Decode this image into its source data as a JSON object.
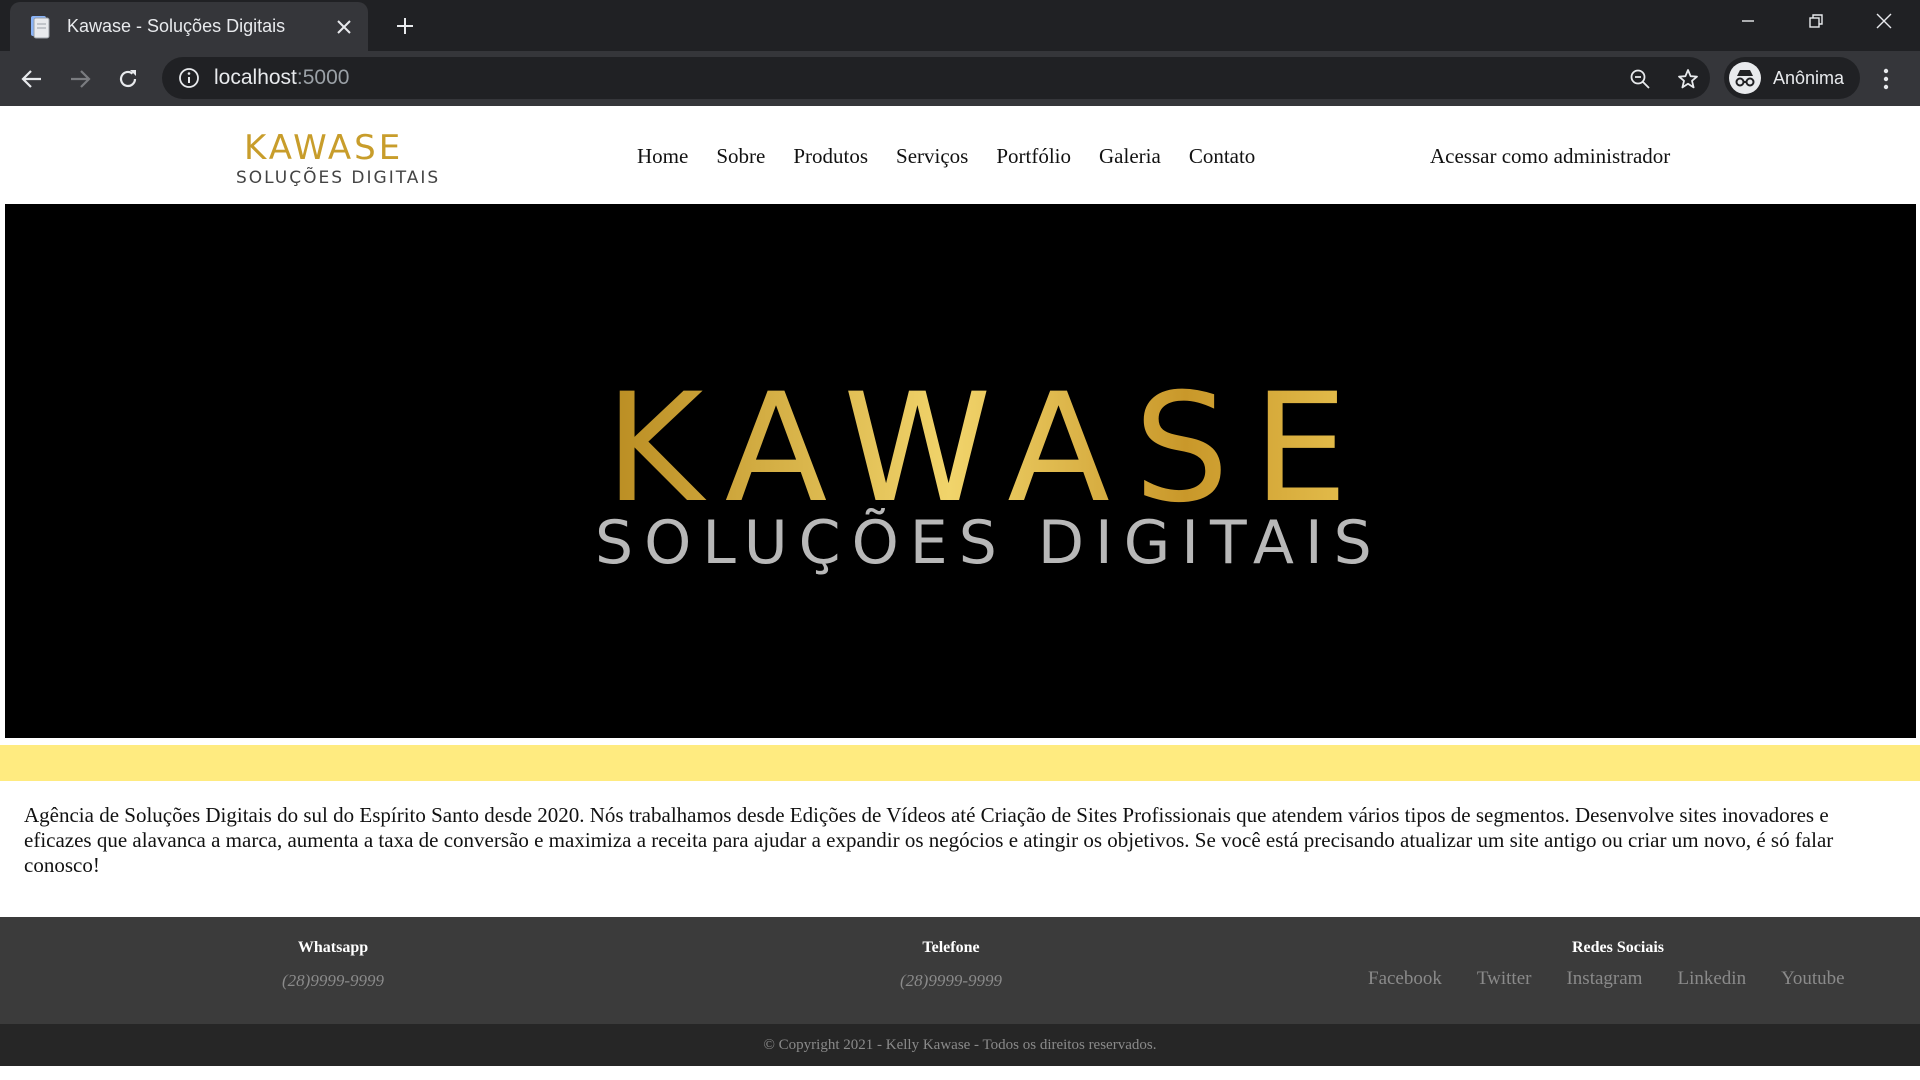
{
  "browser": {
    "tab_title": "Kawase - Soluções Digitais",
    "url_host": "localhost",
    "url_port": ":5000",
    "profile_label": "Anônima"
  },
  "header": {
    "logo_brand": "KAWASE",
    "logo_sub": "SOLUÇÕES DIGITAIS",
    "nav": [
      "Home",
      "Sobre",
      "Produtos",
      "Serviços",
      "Portfólio",
      "Galeria",
      "Contato"
    ],
    "admin_link": "Acessar como administrador"
  },
  "hero": {
    "brand": "KAWASE",
    "sub": "SOLUÇÕES DIGITAIS"
  },
  "about": {
    "text": "Agência de Soluções Digitais do sul do Espírito Santo desde 2020. Nós trabalhamos desde Edições de Vídeos até Criação de Sites Profissionais que atendem vários tipos de segmentos. Desenvolve sites inovadores e eficazes que alavanca a marca, aumenta a taxa de conversão e maximiza a receita para ajudar a expandir os negócios e atingir os objetivos. Se você está precisando atualizar um site antigo ou criar um novo, é só falar conosco!"
  },
  "footer": {
    "whatsapp_title": "Whatsapp",
    "whatsapp_value": "(28)9999-9999",
    "phone_title": "Telefone",
    "phone_value": "(28)9999-9999",
    "social_title": "Redes Sociais",
    "social_links": [
      "Facebook",
      "Twitter",
      "Instagram",
      "Linkedin",
      "Youtube"
    ],
    "copyright": "© Copyright 2021 - Kelly Kawase - Todos os direitos reservados."
  },
  "colors": {
    "accent_yellow": "#ffeb80",
    "gold": "#d4a72c",
    "footer_dark": "#3b3b3b",
    "footer_darker": "#262626"
  }
}
